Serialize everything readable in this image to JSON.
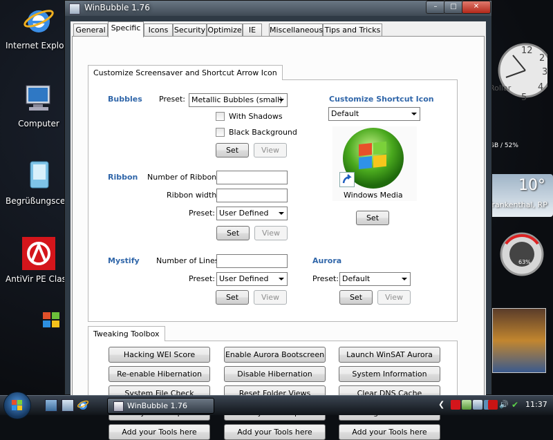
{
  "desktop": {
    "icons": [
      {
        "label": "Internet Explorer",
        "icon": "internet-explorer-icon"
      },
      {
        "label": "Computer",
        "icon": "computer-icon"
      },
      {
        "label": "Begrüßungscenter",
        "icon": "welcome-center-icon"
      },
      {
        "label": "AntiVir PE Classic",
        "icon": "antivir-icon"
      }
    ]
  },
  "gadgets": {
    "clock_brand": "Rollar",
    "cpu_mem": "GB / 52%",
    "weather_temp": "10°",
    "weather_city": "Frankenthal, RP",
    "meter_percent": "63%"
  },
  "window": {
    "title": "WinBubble 1.76",
    "tabs": [
      "General",
      "Specific",
      "Icons",
      "Security",
      "Optimize",
      "IE",
      "Miscellaneous",
      "Tips and Tricks"
    ],
    "active_tab": "Specific",
    "colors": {
      "section_heading": "#3066a9"
    }
  },
  "screensaver": {
    "group_title": "Customize Screensaver and Shortcut Arrow Icon",
    "bubbles": {
      "heading": "Bubbles",
      "preset_label": "Preset:",
      "preset_value": "Metallic Bubbles (small)",
      "with_shadows": "With Shadows",
      "black_background": "Black Background",
      "set": "Set",
      "view": "View"
    },
    "ribbon": {
      "heading": "Ribbon",
      "num_label": "Number of Ribbons:",
      "width_label": "Ribbon width:",
      "preset_label": "Preset:",
      "preset_value": "User Defined",
      "set": "Set",
      "view": "View"
    },
    "mystify": {
      "heading": "Mystify",
      "lines_label": "Number of Lines:",
      "preset_label": "Preset:",
      "preset_value": "User Defined",
      "set": "Set",
      "view": "View"
    },
    "shortcut": {
      "heading": "Customize Shortcut Icon",
      "value": "Default",
      "preview_label": "Windows Media",
      "set": "Set"
    },
    "aurora": {
      "heading": "Aurora",
      "preset_label": "Preset:",
      "preset_value": "Default",
      "set": "Set",
      "view": "View"
    }
  },
  "toolbox": {
    "group_title": "Tweaking Toolbox",
    "buttons": [
      [
        "Hacking WEI Score",
        "Enable Aurora Bootscreen",
        "Launch WinSAT Aurora"
      ],
      [
        "Re-enable Hibernation",
        "Disable Hibernation",
        "System Information"
      ],
      [
        "System File Check",
        "Reset Folder Views",
        "Clear DNS Cache"
      ],
      [
        "Hide your Computer",
        "Show your Computer",
        "WinFlog Control Panel"
      ],
      [
        "Add your Tools here",
        "Add your Tools here",
        "Add your Tools here"
      ]
    ]
  },
  "taskbar": {
    "task_label": "WinBubble 1.76",
    "clock": "11:37"
  }
}
